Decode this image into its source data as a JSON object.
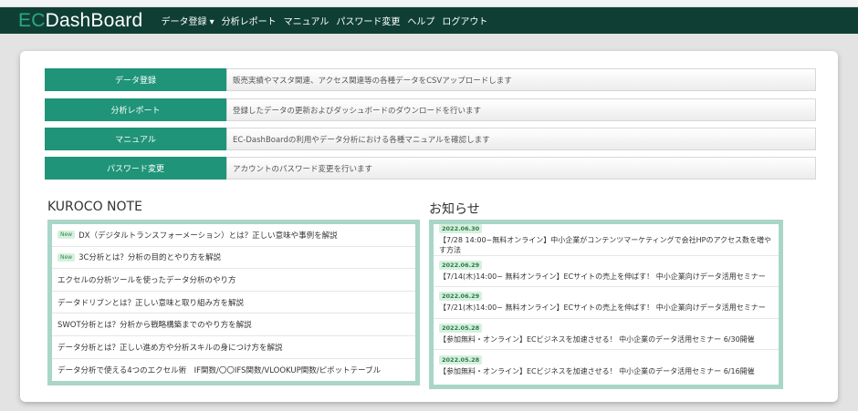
{
  "header": {
    "logo_ec": "EC",
    "logo_rest": "DashBoard",
    "menu": [
      "データ登録 ▾",
      "分析レポート",
      "マニュアル",
      "パスワード変更",
      "ヘルプ",
      "ログアウト"
    ]
  },
  "features": [
    {
      "label": "データ登録",
      "desc": "販売実績やマスタ関連、アクセス関連等の各種データをCSVアップロードします"
    },
    {
      "label": "分析レポート",
      "desc": "登録したデータの更新およびダッシュボードのダウンロードを行います"
    },
    {
      "label": "マニュアル",
      "desc": "EC-DashBoardの利用やデータ分析における各種マニュアルを確認します"
    },
    {
      "label": "パスワード変更",
      "desc": "アカウントのパスワード変更を行います"
    }
  ],
  "kuroco": {
    "title": "KUROCO NOTE",
    "new_badge": "New",
    "items": [
      {
        "new": true,
        "text": "DX（デジタルトランスフォーメーション）とは？正しい意味や事例を解説"
      },
      {
        "new": true,
        "text": "3C分析とは？分析の目的とやり方を解説"
      },
      {
        "new": false,
        "text": "エクセルの分析ツールを使ったデータ分析のやり方"
      },
      {
        "new": false,
        "text": "データドリブンとは？正しい意味と取り組み方を解説"
      },
      {
        "new": false,
        "text": "SWOT分析とは？分析から戦略構築までのやり方を解説"
      },
      {
        "new": false,
        "text": "データ分析とは？正しい進め方や分析スキルの身につけ方を解説"
      },
      {
        "new": false,
        "text": "データ分析で使える4つのエクセル術　IF関数/〇〇IFS関数/VLOOKUP関数/ピボットテーブル"
      }
    ]
  },
  "news": {
    "title": "お知らせ",
    "items": [
      {
        "date": "2022.06.30",
        "text": "【7/28 14:00~無料オンライン】中小企業がコンテンツマーケティングで会社HPのアクセス数を増やす方法"
      },
      {
        "date": "2022.06.29",
        "text": "【7/14(木)14:00~ 無料オンライン】ECサイトの売上を伸ばす！ 中小企業向けデータ活用セミナー"
      },
      {
        "date": "2022.06.29",
        "text": "【7/21(木)14:00~ 無料オンライン】ECサイトの売上を伸ばす！ 中小企業向けデータ活用セミナー"
      },
      {
        "date": "2022.05.28",
        "text": "【参加無料・オンライン】ECビジネスを加速させる！ 中小企業のデータ活用セミナー 6/30開催"
      },
      {
        "date": "2022.05.28",
        "text": "【参加無料・オンライン】ECビジネスを加速させる！ 中小企業のデータ活用セミナー 6/16開催"
      }
    ]
  }
}
